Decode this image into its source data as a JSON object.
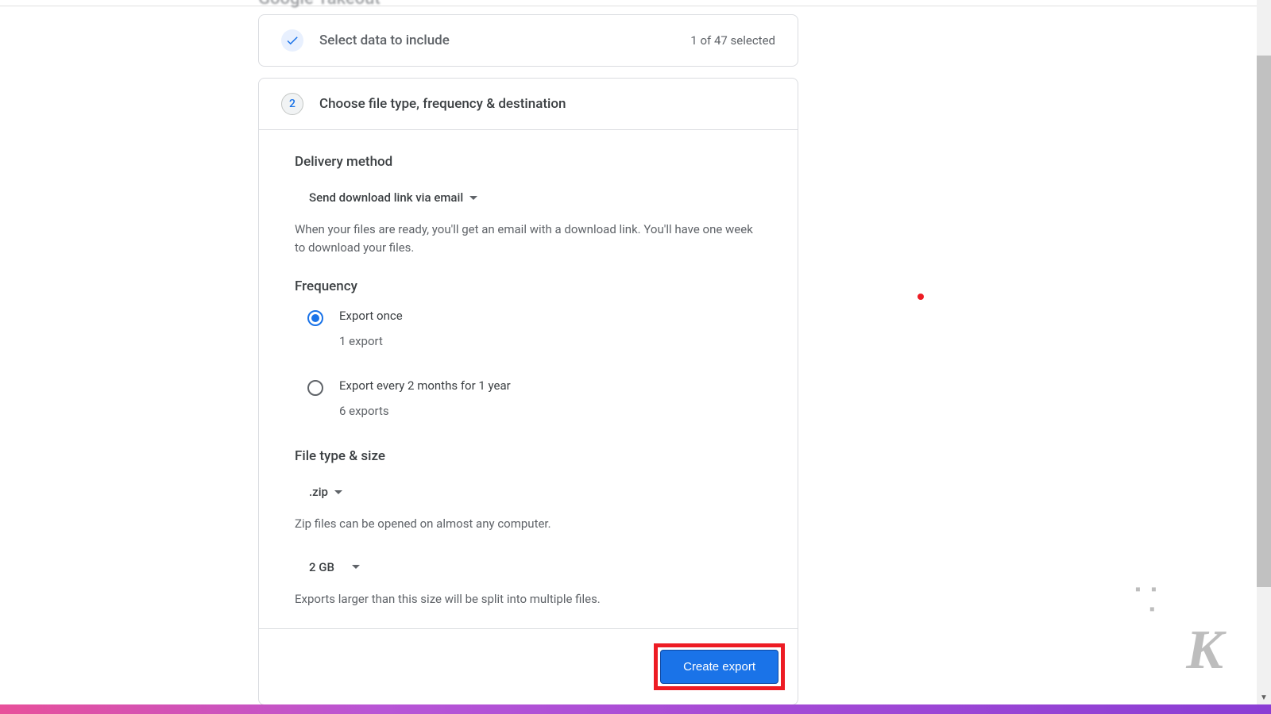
{
  "header": {
    "title": "Google Takeout"
  },
  "step1": {
    "title": "Select data to include",
    "selected": "1 of 47 selected"
  },
  "step2": {
    "number": "2",
    "title": "Choose file type, frequency & destination",
    "delivery": {
      "heading": "Delivery method",
      "selected": "Send download link via email",
      "helper": "When your files are ready, you'll get an email with a download link. You'll have one week to download your files."
    },
    "frequency": {
      "heading": "Frequency",
      "options": [
        {
          "label": "Export once",
          "sublabel": "1 export",
          "selected": true
        },
        {
          "label": "Export every 2 months for 1 year",
          "sublabel": "6 exports",
          "selected": false
        }
      ]
    },
    "filetype": {
      "heading": "File type & size",
      "type": ".zip",
      "type_helper": "Zip files can be opened on almost any computer.",
      "size": "2 GB",
      "size_helper": "Exports larger than this size will be split into multiple files."
    },
    "create_button": "Create export"
  }
}
